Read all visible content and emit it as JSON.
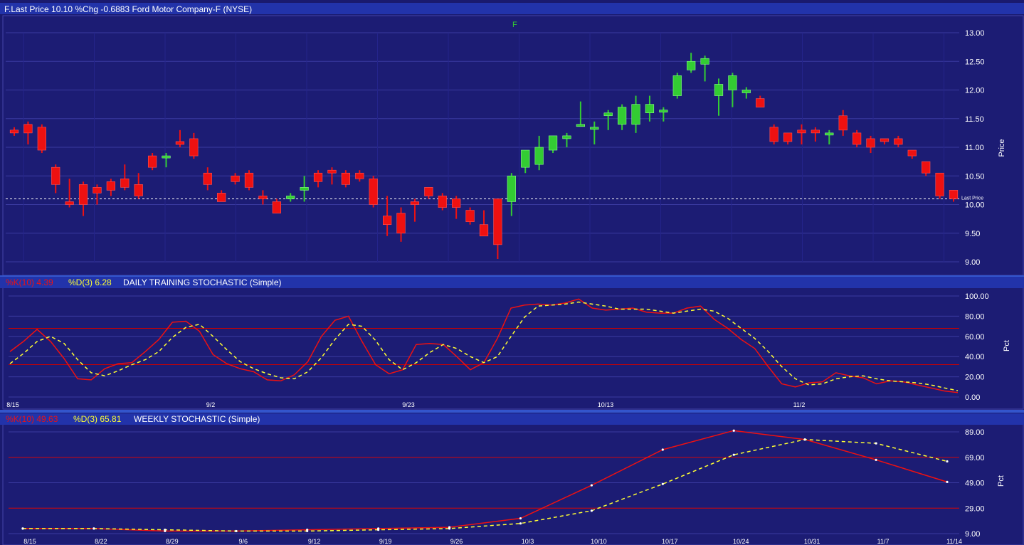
{
  "colors": {
    "background": "#1a1a6e",
    "grid": "#3a3aa0",
    "up": "#33cc33",
    "down": "#ee1111",
    "k_line": "#ee1111",
    "d_line": "#ffff33",
    "level_line": "#cc0000",
    "header_bar": "#2233aa"
  },
  "price_panel": {
    "header": {
      "text": "F.Last Price 10.10 %Chg -0.6883  Ford Motor Company-F          (NYSE)"
    },
    "symbol": "F",
    "ylabel": "Price",
    "last_price_label": "Last Price",
    "y_ticks": [
      "13.00",
      "12.50",
      "12.00",
      "11.50",
      "11.00",
      "10.50",
      "10.00",
      "9.50",
      "9.00"
    ]
  },
  "daily_panel": {
    "header": {
      "k": "%K(10) 4.39",
      "d": "%D(3) 6.28",
      "title": "DAILY TRAINING STOCHASTIC (Simple)"
    },
    "ylabel": "Pct",
    "y_ticks": [
      "100.00",
      "80.00",
      "60.00",
      "40.00",
      "20.00",
      "0.00"
    ],
    "x_ticks": [
      "8/15",
      "9/2",
      "9/23",
      "10/13",
      "11/2"
    ]
  },
  "weekly_panel": {
    "header": {
      "k": "%K(10) 49.63",
      "d": "%D(3) 65.81",
      "title": "WEEKLY STOCHASTIC (Simple)"
    },
    "ylabel": "Pct",
    "y_ticks": [
      "89.00",
      "69.00",
      "49.00",
      "29.00",
      "9.00"
    ],
    "x_ticks": [
      "8/15",
      "8/22",
      "8/29",
      "9/6",
      "9/12",
      "9/19",
      "9/26",
      "10/3",
      "10/10",
      "10/17",
      "10/24",
      "10/31",
      "11/7",
      "11/14"
    ]
  },
  "chart_data": [
    {
      "type": "candlestick",
      "title": "F.Last Price 10.10 %Chg -0.6883  Ford Motor Company-F (NYSE)",
      "ylabel": "Price",
      "ylim": [
        9.0,
        13.0
      ],
      "last_price": 10.1,
      "candles": [
        [
          11.3,
          11.35,
          11.2,
          11.25
        ],
        [
          11.4,
          11.45,
          11.05,
          11.25
        ],
        [
          11.35,
          11.4,
          10.9,
          10.95
        ],
        [
          10.65,
          10.7,
          10.2,
          10.35
        ],
        [
          10.05,
          10.45,
          9.95,
          10.0
        ],
        [
          10.35,
          10.4,
          9.8,
          10.0
        ],
        [
          10.3,
          10.35,
          10.0,
          10.2
        ],
        [
          10.4,
          10.45,
          10.15,
          10.25
        ],
        [
          10.45,
          10.7,
          10.25,
          10.3
        ],
        [
          10.35,
          10.55,
          10.1,
          10.15
        ],
        [
          10.85,
          10.9,
          10.6,
          10.65
        ],
        [
          10.85,
          10.9,
          10.65,
          10.85
        ],
        [
          11.1,
          11.3,
          11.0,
          11.05
        ],
        [
          11.15,
          11.25,
          10.8,
          10.85
        ],
        [
          10.55,
          10.65,
          10.25,
          10.35
        ],
        [
          10.2,
          10.25,
          10.05,
          10.05
        ],
        [
          10.5,
          10.55,
          10.35,
          10.4
        ],
        [
          10.55,
          10.6,
          10.25,
          10.3
        ],
        [
          10.15,
          10.25,
          10.0,
          10.1
        ],
        [
          10.05,
          10.1,
          9.85,
          9.85
        ],
        [
          10.1,
          10.2,
          10.05,
          10.15
        ],
        [
          10.25,
          10.5,
          10.05,
          10.3
        ],
        [
          10.55,
          10.6,
          10.3,
          10.4
        ],
        [
          10.6,
          10.65,
          10.35,
          10.55
        ],
        [
          10.55,
          10.6,
          10.3,
          10.35
        ],
        [
          10.55,
          10.6,
          10.4,
          10.45
        ],
        [
          10.45,
          10.5,
          9.95,
          10.0
        ],
        [
          9.8,
          10.15,
          9.45,
          9.65
        ],
        [
          9.85,
          9.95,
          9.35,
          9.5
        ],
        [
          10.05,
          10.1,
          9.7,
          10.0
        ],
        [
          10.3,
          10.3,
          10.1,
          10.15
        ],
        [
          10.15,
          10.2,
          9.9,
          9.95
        ],
        [
          10.1,
          10.15,
          9.75,
          9.95
        ],
        [
          9.9,
          9.95,
          9.65,
          9.7
        ],
        [
          9.65,
          9.9,
          9.55,
          9.45
        ],
        [
          10.1,
          10.1,
          9.05,
          9.3
        ],
        [
          10.05,
          10.55,
          9.8,
          10.5
        ],
        [
          10.65,
          10.95,
          10.55,
          10.95
        ],
        [
          10.7,
          11.2,
          10.6,
          11.0
        ],
        [
          10.95,
          11.2,
          10.9,
          11.2
        ],
        [
          11.15,
          11.25,
          11.0,
          11.2
        ],
        [
          11.4,
          11.8,
          11.4,
          11.4
        ],
        [
          11.35,
          11.45,
          11.05,
          11.35
        ],
        [
          11.55,
          11.65,
          11.3,
          11.6
        ],
        [
          11.4,
          11.75,
          11.3,
          11.7
        ],
        [
          11.4,
          11.9,
          11.25,
          11.75
        ],
        [
          11.6,
          11.9,
          11.45,
          11.75
        ],
        [
          11.65,
          11.7,
          11.45,
          11.65
        ],
        [
          11.9,
          12.3,
          11.85,
          12.25
        ],
        [
          12.35,
          12.65,
          12.3,
          12.5
        ],
        [
          12.45,
          12.6,
          12.15,
          12.55
        ],
        [
          11.9,
          12.2,
          11.55,
          12.1
        ],
        [
          12.0,
          12.3,
          11.7,
          12.25
        ],
        [
          11.95,
          12.05,
          11.85,
          12.0
        ],
        [
          11.85,
          11.9,
          11.7,
          11.7
        ],
        [
          11.35,
          11.4,
          11.05,
          11.1
        ],
        [
          11.25,
          11.25,
          11.05,
          11.1
        ],
        [
          11.3,
          11.4,
          11.05,
          11.25
        ],
        [
          11.3,
          11.35,
          11.1,
          11.25
        ],
        [
          11.25,
          11.3,
          11.05,
          11.25
        ],
        [
          11.55,
          11.65,
          11.2,
          11.3
        ],
        [
          11.25,
          11.3,
          11.0,
          11.05
        ],
        [
          11.15,
          11.2,
          10.9,
          11.0
        ],
        [
          11.15,
          11.15,
          11.05,
          11.1
        ],
        [
          11.15,
          11.2,
          11.0,
          11.05
        ],
        [
          10.95,
          10.95,
          10.8,
          10.85
        ],
        [
          10.75,
          10.75,
          10.5,
          10.55
        ],
        [
          10.55,
          10.55,
          10.1,
          10.15
        ],
        [
          10.25,
          10.25,
          10.05,
          10.1
        ]
      ]
    },
    {
      "type": "line",
      "title": "%K(10) 4.39 %D(3) 6.28 DAILY TRAINING STOCHASTIC (Simple)",
      "ylabel": "Pct",
      "ylim": [
        0,
        100
      ],
      "levels": [
        68,
        32
      ],
      "x_ticks": [
        "8/15",
        "9/2",
        "9/23",
        "10/13",
        "11/2"
      ],
      "series": [
        {
          "name": "%K(10)",
          "values": [
            45,
            55,
            67,
            55,
            38,
            18,
            17,
            28,
            33,
            34,
            45,
            57,
            74,
            75,
            65,
            42,
            33,
            28,
            25,
            17,
            16,
            22,
            35,
            60,
            76,
            80,
            55,
            32,
            23,
            27,
            52,
            53,
            52,
            40,
            27,
            34,
            58,
            88,
            91,
            92,
            91,
            93,
            97,
            88,
            86,
            87,
            88,
            84,
            83,
            83,
            88,
            90,
            77,
            68,
            57,
            48,
            30,
            13,
            10,
            14,
            15,
            24,
            21,
            19,
            13,
            16,
            15,
            12,
            9,
            6,
            4.39
          ]
        },
        {
          "name": "%D(3)",
          "values": [
            33,
            43,
            55,
            60,
            53,
            37,
            24,
            21,
            26,
            32,
            37,
            45,
            59,
            69,
            72,
            60,
            47,
            35,
            28,
            23,
            19,
            18,
            25,
            39,
            57,
            72,
            70,
            56,
            37,
            27,
            34,
            44,
            52,
            48,
            40,
            34,
            40,
            60,
            79,
            90,
            91,
            92,
            94,
            92,
            90,
            87,
            87,
            87,
            85,
            83,
            85,
            87,
            85,
            78,
            68,
            58,
            45,
            30,
            18,
            12,
            13,
            18,
            20,
            21,
            18,
            16,
            15,
            14,
            12,
            9,
            6.28
          ]
        }
      ]
    },
    {
      "type": "line",
      "title": "%K(10) 49.63 %D(3) 65.81 WEEKLY STOCHASTIC (Simple)",
      "ylabel": "Pct",
      "ylim": [
        9,
        89
      ],
      "levels": [
        69,
        29
      ],
      "categories": [
        "8/15",
        "8/22",
        "8/29",
        "9/6",
        "9/12",
        "9/19",
        "9/26",
        "10/3",
        "10/10",
        "10/17",
        "10/24",
        "10/31",
        "11/7",
        "11/14"
      ],
      "series": [
        {
          "name": "%K(10)",
          "values": [
            13,
            13,
            11,
            11,
            12,
            13,
            14,
            21,
            47,
            75,
            90,
            83,
            67,
            49.63
          ]
        },
        {
          "name": "%D(3)",
          "values": [
            13,
            13,
            12,
            11,
            11,
            12,
            13,
            17,
            27,
            48,
            71,
            83,
            80,
            65.81
          ]
        }
      ]
    }
  ]
}
